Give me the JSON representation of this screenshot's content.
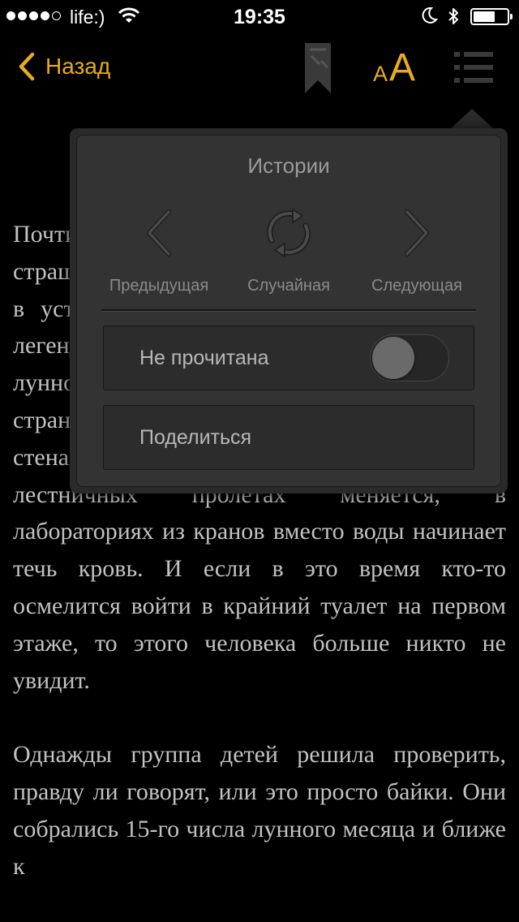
{
  "status_bar": {
    "carrier": "life:)",
    "time": "19:35",
    "signal_bars_filled": 4,
    "signal_bars_total": 5
  },
  "nav": {
    "back_label": "Назад",
    "font_small": "A",
    "font_large": "A"
  },
  "popup": {
    "title": "Истории",
    "prev_label": "Предыдущая",
    "random_label": "Случайная",
    "next_label": "Следующая",
    "unread_label": "Не прочитана",
    "unread_toggle_on": false,
    "share_label": "Поделиться"
  },
  "article": {
    "paragraphs": [
      "Почти в каждой школе можно услышать страшные истории, которые передаются из уст в уста. Говорят, что среди учеников ходит легенда о том, что 15-го числа каждого лунного месяца в старой школе происходят странные вещи: например, у портретов на стенах вращаются глаза, число ступенек в лестничных пролётах меняется, в лабораториях из кранов вместо воды начинает течь кровь. И если в это время кто-то осмелится войти в крайний туалет на первом этаже, то этого человека больше никто не увидит.",
      "Однажды группа детей решила проверить, правду ли говорят, или это просто байки. Они собрались 15-го числа лунного месяца и ближе к"
    ]
  },
  "colors": {
    "accent": "#e8ac1c",
    "background": "#000000",
    "text": "#c2c2c2",
    "popup_bg": "#333333"
  },
  "icons": {
    "back": "chevron-left-icon",
    "bookmark": "bookmark-icon",
    "font": "font-size-icon",
    "list": "list-icon",
    "prev": "chevron-left-icon",
    "random": "refresh-icon",
    "next": "chevron-right-icon"
  }
}
